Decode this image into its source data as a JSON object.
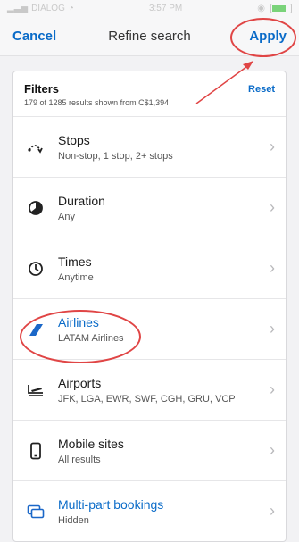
{
  "status": {
    "carrier": "DIALOG",
    "time": "3:57 PM"
  },
  "header": {
    "cancel": "Cancel",
    "title": "Refine search",
    "apply": "Apply"
  },
  "filters": {
    "title": "Filters",
    "summary": "179 of 1285 results shown from C$1,394",
    "reset": "Reset"
  },
  "rows": [
    {
      "label": "Stops",
      "value": "Non-stop, 1 stop, 2+ stops",
      "icon": "stops-icon"
    },
    {
      "label": "Duration",
      "value": "Any",
      "icon": "duration-icon"
    },
    {
      "label": "Times",
      "value": "Anytime",
      "icon": "clock-icon"
    },
    {
      "label": "Airlines",
      "value": "LATAM Airlines",
      "icon": "airline-tail-icon",
      "highlight_color": "#0a6bc8"
    },
    {
      "label": "Airports",
      "value": "JFK, LGA, EWR, SWF, CGH, GRU, VCP",
      "icon": "airport-icon"
    },
    {
      "label": "Mobile sites",
      "value": "All results",
      "icon": "mobile-icon"
    },
    {
      "label": "Multi-part bookings",
      "value": "Hidden",
      "icon": "multipart-icon",
      "highlight_color": "#0a6bc8"
    }
  ],
  "colors": {
    "accent": "#0a6bc8",
    "annotation": "#e04545"
  }
}
